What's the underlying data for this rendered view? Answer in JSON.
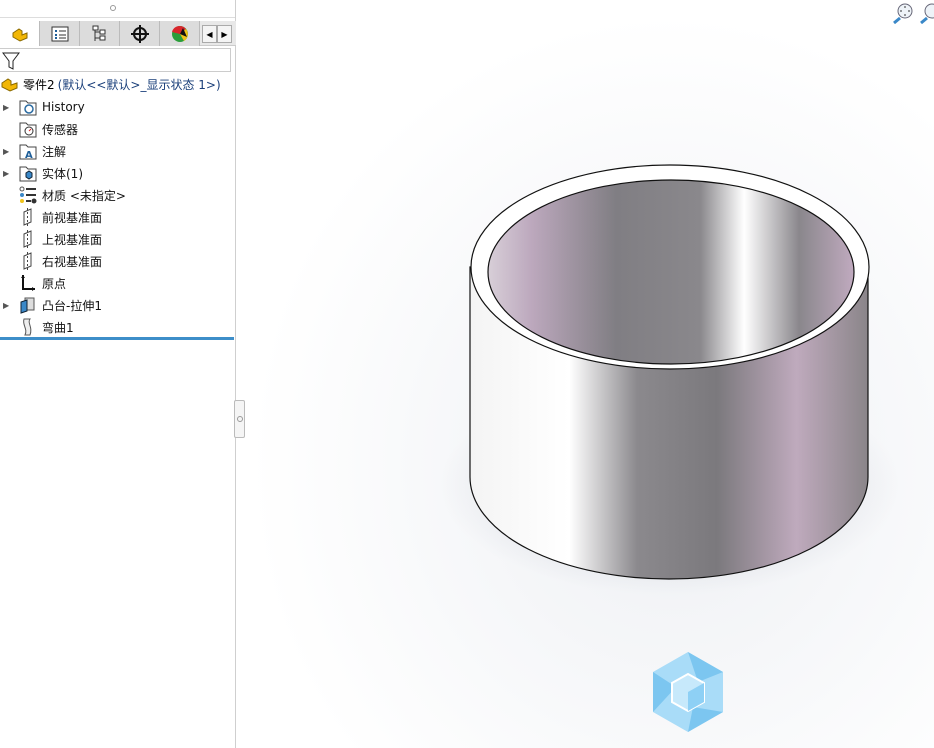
{
  "sidebar": {
    "tabs": [
      "feature-manager",
      "property-manager",
      "configuration-manager",
      "dimxpert-manager",
      "display-manager"
    ],
    "root": {
      "name": "零件2",
      "config": "(默认<<默认>_显示状态 1>)"
    },
    "items": [
      {
        "label": "History",
        "icon": "history-folder-icon",
        "expandable": true
      },
      {
        "label": "传感器",
        "icon": "sensor-folder-icon",
        "expandable": false
      },
      {
        "label": "注解",
        "icon": "annotation-folder-icon",
        "expandable": true
      },
      {
        "label": "实体(1)",
        "icon": "solid-bodies-folder-icon",
        "expandable": true
      },
      {
        "label": "材质 <未指定>",
        "icon": "material-icon",
        "expandable": false
      },
      {
        "label": "前视基准面",
        "icon": "plane-icon",
        "expandable": false
      },
      {
        "label": "上视基准面",
        "icon": "plane-icon",
        "expandable": false
      },
      {
        "label": "右视基准面",
        "icon": "plane-icon",
        "expandable": false
      },
      {
        "label": "原点",
        "icon": "origin-icon",
        "expandable": false
      },
      {
        "label": "凸台-拉伸1",
        "icon": "extrude-icon",
        "expandable": true
      },
      {
        "label": "弯曲1",
        "icon": "flex-icon",
        "expandable": false
      }
    ]
  },
  "colors": {
    "accent": "#3d8ec9",
    "logo": "#9fd4f5"
  }
}
